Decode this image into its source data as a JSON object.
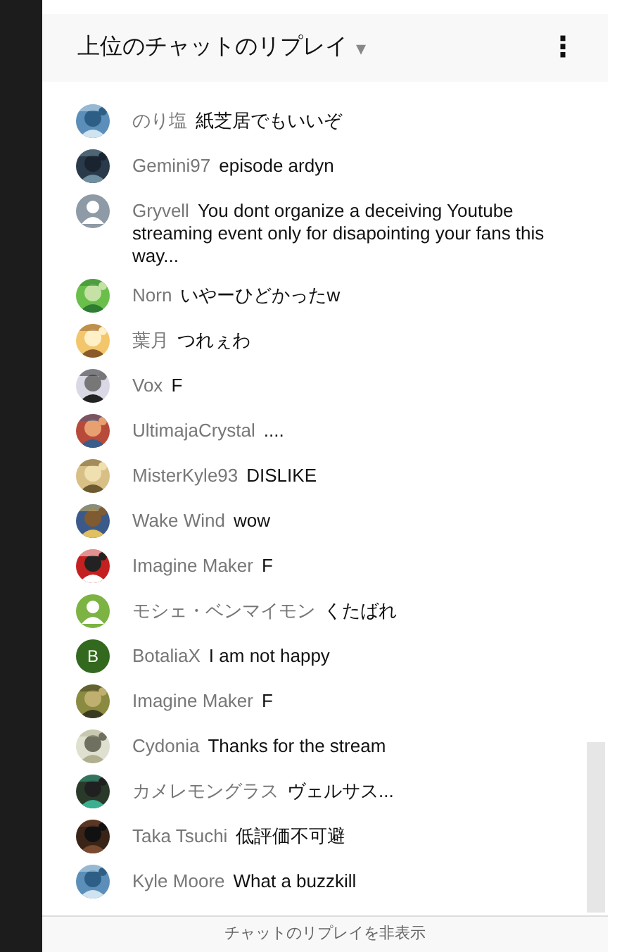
{
  "header": {
    "title": "上位のチャットのリプレイ",
    "dropdown_caret": "▾",
    "menu": "⋮"
  },
  "messages": [
    {
      "author": "のり塩",
      "text": "紙芝居でもいいぞ"
    },
    {
      "author": "Gemini97",
      "text": "episode ardyn"
    },
    {
      "author": "Gryvell",
      "text": "You dont organize a deceiving Youtube streaming event only for disapointing your fans this way...",
      "avatar": {
        "kind": "default",
        "color": "#8e9aa6"
      }
    },
    {
      "author": "Norn",
      "text": "いやーひどかったw"
    },
    {
      "author": "葉月",
      "text": "つれぇわ"
    },
    {
      "author": "Vox",
      "text": "F"
    },
    {
      "author": "UltimajaCrystal",
      "text": "...."
    },
    {
      "author": "MisterKyle93",
      "text": "DISLIKE"
    },
    {
      "author": "Wake Wind",
      "text": "wow"
    },
    {
      "author": "Imagine Maker",
      "text": "F"
    },
    {
      "author": "モシェ・ベンマイモン",
      "text": "くたばれ",
      "avatar": {
        "kind": "default",
        "color": "#7cb342"
      }
    },
    {
      "author": "BotaliaX",
      "text": "I am not happy",
      "avatar": {
        "kind": "letter",
        "letter": "B",
        "color": "#33691e"
      }
    },
    {
      "author": "Imagine Maker",
      "text": "F"
    },
    {
      "author": "Cydonia",
      "text": "Thanks for the stream"
    },
    {
      "author": "カメレモングラス",
      "text": "ヴェルサス..."
    },
    {
      "author": "Taka Tsuchi",
      "text": "低評価不可避"
    },
    {
      "author": "Kyle Moore",
      "text": "What a buzzkill"
    }
  ],
  "footer": {
    "label": "チャットのリプレイを非表示"
  }
}
